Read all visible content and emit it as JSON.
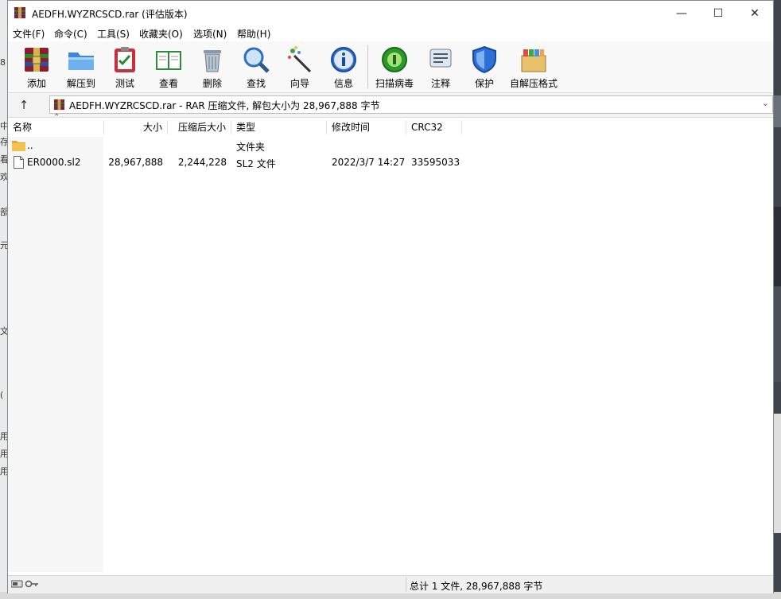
{
  "window": {
    "title": "AEDFH.WYZRCSCD.rar (评估版本)",
    "minimize": "—",
    "maximize": "☐",
    "close": "✕"
  },
  "menu": [
    "文件(F)",
    "命令(C)",
    "工具(S)",
    "收藏夹(O)",
    "选项(N)",
    "帮助(H)"
  ],
  "toolbar": [
    {
      "label": "添加",
      "icon": "add-archive-icon"
    },
    {
      "label": "解压到",
      "icon": "extract-folder-icon"
    },
    {
      "label": "测试",
      "icon": "test-clipboard-icon"
    },
    {
      "label": "查看",
      "icon": "view-book-icon"
    },
    {
      "label": "删除",
      "icon": "trash-can-icon"
    },
    {
      "label": "查找",
      "icon": "magnifier-icon"
    },
    {
      "label": "向导",
      "icon": "magic-wand-icon"
    },
    {
      "label": "信息",
      "icon": "info-icon"
    },
    {
      "label": "扫描病毒",
      "icon": "virus-scan-icon"
    },
    {
      "label": "注释",
      "icon": "comment-icon"
    },
    {
      "label": "保护",
      "icon": "shield-icon"
    },
    {
      "label": "自解压格式",
      "icon": "sfx-box-icon"
    }
  ],
  "address": {
    "up": "↑",
    "path": "AEDFH.WYZRCSCD.rar - RAR 压缩文件, 解包大小为 28,967,888 字节"
  },
  "columns": {
    "name": "名称",
    "size": "大小",
    "packed": "压缩后大小",
    "type": "类型",
    "modified": "修改时间",
    "crc": "CRC32"
  },
  "rows": [
    {
      "name": "..",
      "size": "",
      "packed": "",
      "type": "文件夹",
      "modified": "",
      "crc": ""
    },
    {
      "name": "ER0000.sl2",
      "size": "28,967,888",
      "packed": "2,244,228",
      "type": "SL2 文件",
      "modified": "2022/3/7 14:27",
      "crc": "33595033"
    }
  ],
  "status": {
    "summary": "总计 1 文件, 28,967,888 字节"
  },
  "colors": {
    "accent_green": "#2a9a2a",
    "folder_yellow": "#f2c14e",
    "info_blue": "#2f6fd6"
  }
}
